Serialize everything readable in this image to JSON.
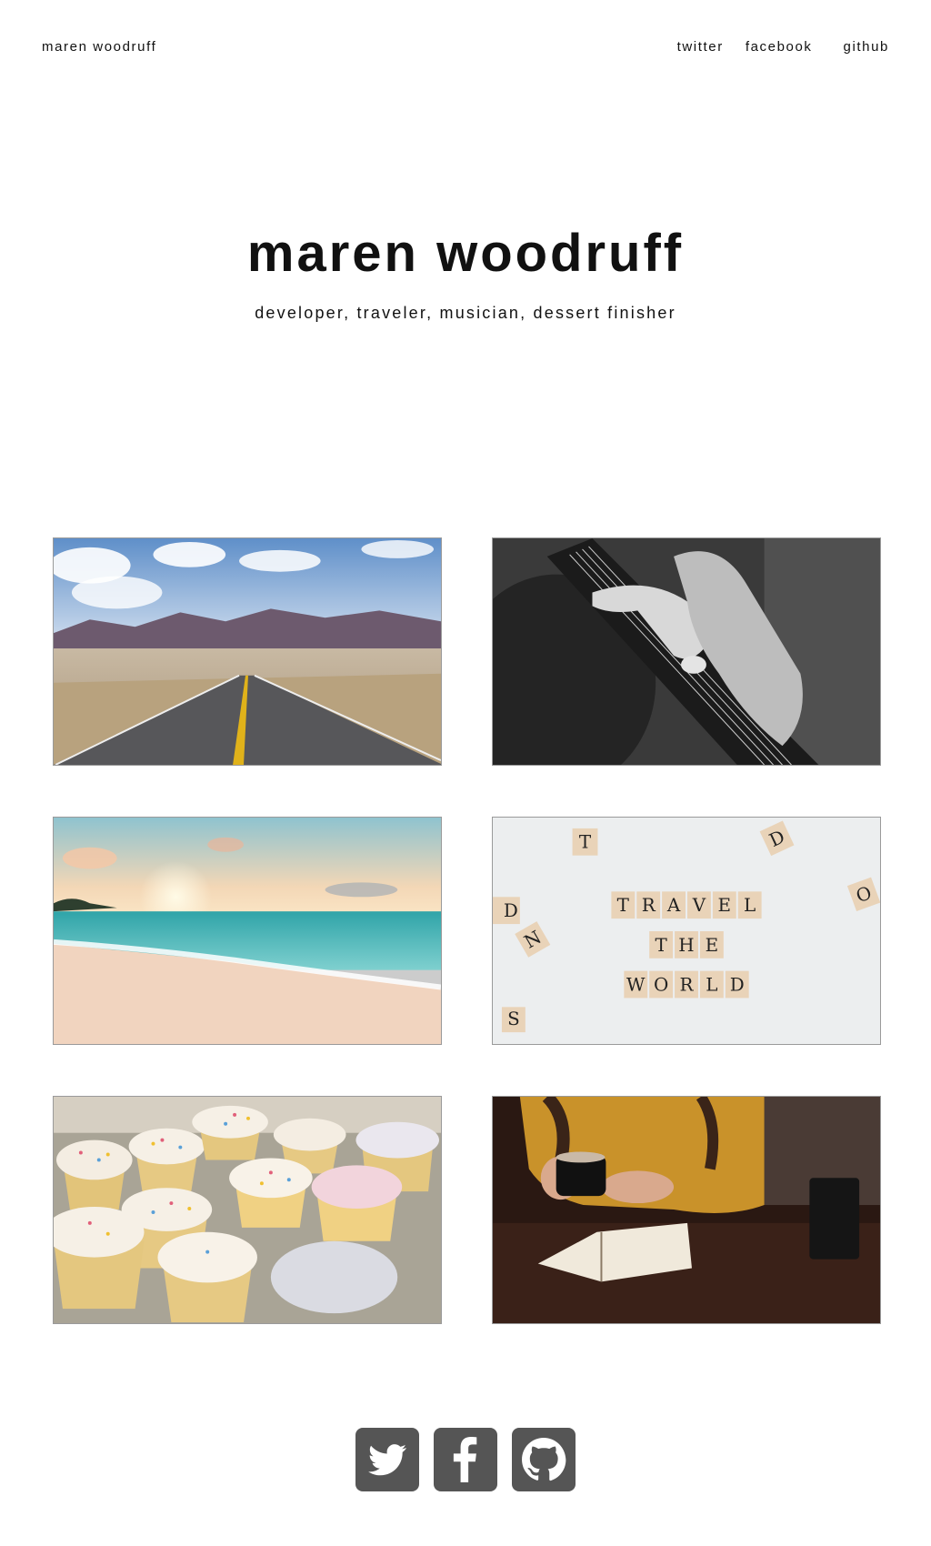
{
  "nav": {
    "brand": "maren woodruff",
    "links": [
      "twitter",
      "facebook",
      "github"
    ]
  },
  "hero": {
    "title": "maren woodruff",
    "subtitle": "developer, traveler, musician, dessert finisher"
  },
  "gallery": {
    "tiles": [
      {
        "icon": "desert-road-photo"
      },
      {
        "icon": "guitar-hand-photo"
      },
      {
        "icon": "beach-sunset-photo"
      },
      {
        "icon": "scrabble-tiles-photo",
        "scrabble_lines": [
          "TRAVEL",
          "THE",
          "WORLD"
        ]
      },
      {
        "icon": "cupcakes-photo"
      },
      {
        "icon": "coffee-book-photo"
      }
    ]
  },
  "footer": {
    "icons": [
      "twitter-icon",
      "facebook-icon",
      "github-icon"
    ]
  },
  "colors": {
    "text": "#111111",
    "icon_bg": "#555555",
    "tile_border": "#9a9a9a"
  }
}
